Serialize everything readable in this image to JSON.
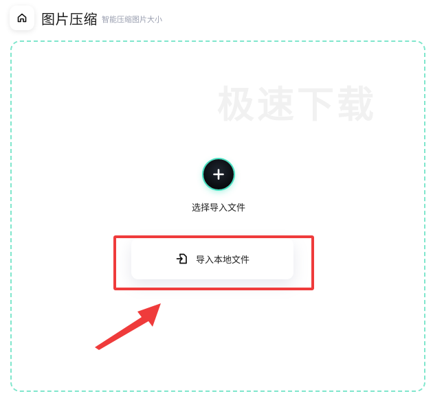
{
  "header": {
    "home_icon": "home-icon",
    "title": "图片压缩",
    "subtitle": "智能压缩图片大小"
  },
  "dropzone": {
    "watermark": "极速下载",
    "add_icon": "plus-icon",
    "add_label": "选择导入文件",
    "import_icon": "file-import-icon",
    "import_label": "导入本地文件"
  },
  "colors": {
    "dashed_border": "#7fe6cc",
    "accent_glow": "#45e0c0",
    "highlight": "#ef3b3b",
    "add_button": "#0b0e13"
  }
}
